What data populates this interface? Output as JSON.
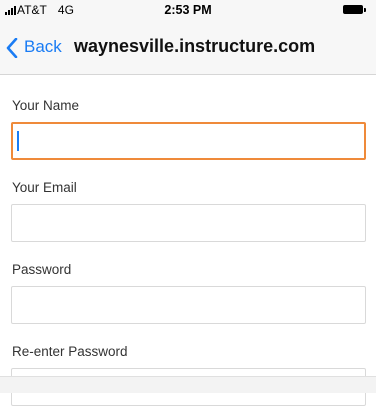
{
  "status_bar": {
    "carrier": "AT&T",
    "network": "4G",
    "time": "2:53 PM",
    "battery_level": 1.0
  },
  "nav": {
    "back_label": "Back",
    "title": "waynesville.instructure.com"
  },
  "form": {
    "fields": [
      {
        "label": "Your Name",
        "value": "",
        "focused": true
      },
      {
        "label": "Your Email",
        "value": ""
      },
      {
        "label": "Password",
        "value": ""
      },
      {
        "label": "Re-enter Password",
        "value": ""
      }
    ]
  },
  "colors": {
    "link_blue": "#1a7cf4",
    "focus_border": "#ef8a3a"
  }
}
